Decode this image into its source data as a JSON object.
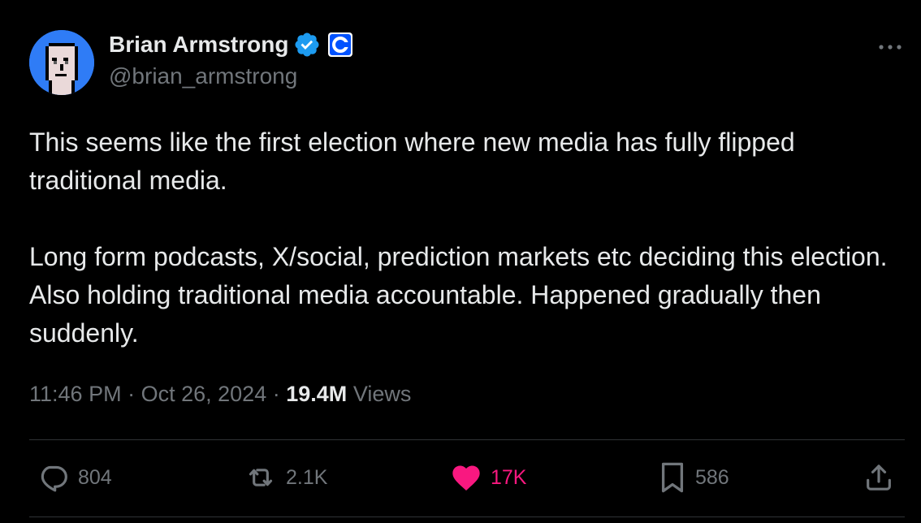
{
  "author": {
    "display_name": "Brian Armstrong",
    "handle": "@brian_armstrong"
  },
  "tweet": {
    "paragraphs": [
      "This seems like the first election where new media has fully flipped traditional media.",
      "Long form podcasts, X/social, prediction markets etc deciding this election. Also holding traditional media accountable. Happened gradually then suddenly."
    ],
    "time": "11:46 PM",
    "separator": "·",
    "date": "Oct 26, 2024",
    "views_count": "19.4M",
    "views_label": "Views"
  },
  "actions": {
    "replies": "804",
    "reposts": "2.1K",
    "likes": "17K",
    "bookmarks": "586"
  },
  "icons": {
    "verified": "verified-badge-icon",
    "affiliate": "coinbase-logo-icon",
    "more": "more-dots-icon",
    "reply": "reply-bubble-icon",
    "repost": "repost-arrows-icon",
    "like": "heart-filled-icon",
    "bookmark": "bookmark-icon",
    "share": "share-upload-icon"
  },
  "colors": {
    "background": "#000000",
    "text": "#e7e9ea",
    "secondary": "#71767b",
    "verified": "#1d9bf0",
    "like": "#f91880",
    "affiliate": "#0052ff",
    "avatar_bg": "#2f7cf6"
  }
}
